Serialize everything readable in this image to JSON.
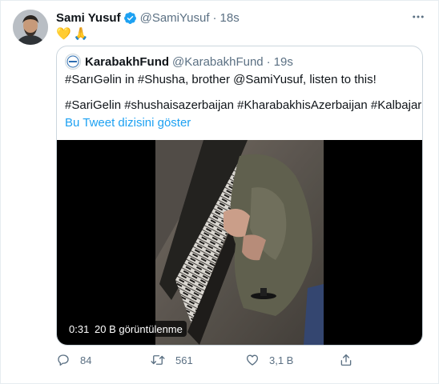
{
  "tweet": {
    "author_name": "Sami Yusuf",
    "author_handle": "@SamiYusuf",
    "separator": "·",
    "time": "18s",
    "body_emoji": [
      "💛",
      "🙏"
    ],
    "verified_icon": "verified-badge-icon",
    "more_icon": "more-horizontal-icon"
  },
  "quote": {
    "author_name": "KarabakhFund",
    "author_handle": "@KarabakhFund",
    "separator": "·",
    "time": "19s",
    "line1": "#SarıGəlin in #Shusha, brother @SamiYusuf, listen to this!",
    "line2": "#SariGelin #shushaisazerbaijan #KharabakhisAzerbaijan #Kalbajar",
    "show_thread": "Bu Tweet dizisini göster",
    "video": {
      "duration": "0:31",
      "views": "20 B görüntülenme"
    }
  },
  "actions": {
    "reply_count": "84",
    "retweet_count": "561",
    "like_count": "3,1 B"
  },
  "colors": {
    "link": "#1da1f2",
    "secondary_text": "#5b7083",
    "verified": "#1da1f2",
    "border": "#ccd6dd"
  }
}
